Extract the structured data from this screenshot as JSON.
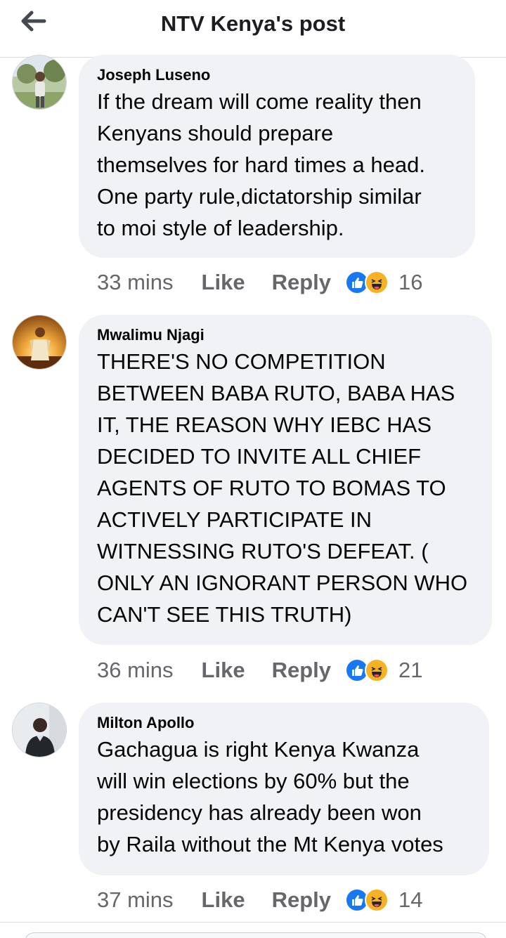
{
  "header": {
    "title": "NTV Kenya's post"
  },
  "comments": [
    {
      "author": "Joseph Luseno",
      "text": "If the dream will come reality then\nKenyans should prepare\nthemselves for hard times a head.\nOne party rule,dictatorship similar\nto moi style of leadership.",
      "time": "33 mins",
      "like_label": "Like",
      "reply_label": "Reply",
      "reaction_count": "16"
    },
    {
      "author": "Mwalimu Njagi",
      "text": "THERE'S NO COMPETITION\nBETWEEN BABA RUTO, BABA HAS\nIT, THE REASON WHY IEBC HAS\nDECIDED TO INVITE ALL CHIEF\nAGENTS OF RUTO TO BOMAS TO\nACTIVELY PARTICIPATE IN\nWITNESSING RUTO'S DEFEAT. (\nONLY AN IGNORANT PERSON WHO\nCAN'T SEE THIS TRUTH)",
      "time": "36 mins",
      "like_label": "Like",
      "reply_label": "Reply",
      "reaction_count": "21"
    },
    {
      "author": "Milton Apollo",
      "text": "Gachagua is right Kenya Kwanza\nwill win elections by 60% but the\npresidency has already been won\nby Raila without the Mt Kenya votes",
      "time": "37 mins",
      "like_label": "Like",
      "reply_label": "Reply",
      "reaction_count": "14"
    }
  ],
  "icons": {
    "back": "arrow-left-icon",
    "like_reaction": "thumbs-up-icon",
    "haha_reaction": "laughing-face-icon"
  },
  "colors": {
    "bubble": "#f0f2f5",
    "meta_text": "#65676b",
    "like_blue": "#1877f2",
    "haha_yellow": "#f7b125"
  }
}
